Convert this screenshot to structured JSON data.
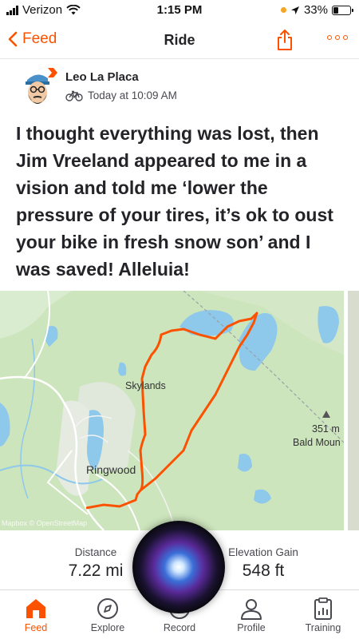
{
  "status_bar": {
    "carrier": "Verizon",
    "time": "1:15 PM",
    "battery_percent": "33%",
    "battery_level": 0.33
  },
  "nav": {
    "back_label": "Feed",
    "title": "Ride",
    "accent_color": "#fc5200"
  },
  "activity": {
    "athlete_name": "Leo  La Placa",
    "timestamp": "Today at 10:09 AM",
    "type_icon": "bike-icon",
    "title": "I thought everything was lost, then Jim Vreeland appeared to me in a vision and told me ‘lower the pressure of your tires, it’s ok to oust your bike in fresh snow son’ and I was saved! Alleluia!"
  },
  "map": {
    "labels": {
      "skylands": "Skylands",
      "ringwood": "Ringwood",
      "elevation": "351 m",
      "peak": "Bald Moun",
      "attribution": "Mapbox © OpenStreetMap"
    },
    "route_color": "#fc5200"
  },
  "stats": {
    "distance": {
      "label": "Distance",
      "value": "7.22 mi"
    },
    "elevation": {
      "label": "Elevation Gain",
      "value": "548 ft"
    }
  },
  "tabs": [
    {
      "label": "Feed",
      "icon": "home-icon",
      "active": true
    },
    {
      "label": "Explore",
      "icon": "compass-icon",
      "active": false
    },
    {
      "label": "Record",
      "icon": "record-icon",
      "active": false
    },
    {
      "label": "Profile",
      "icon": "profile-icon",
      "active": false
    },
    {
      "label": "Training",
      "icon": "clipboard-icon",
      "active": false
    }
  ]
}
